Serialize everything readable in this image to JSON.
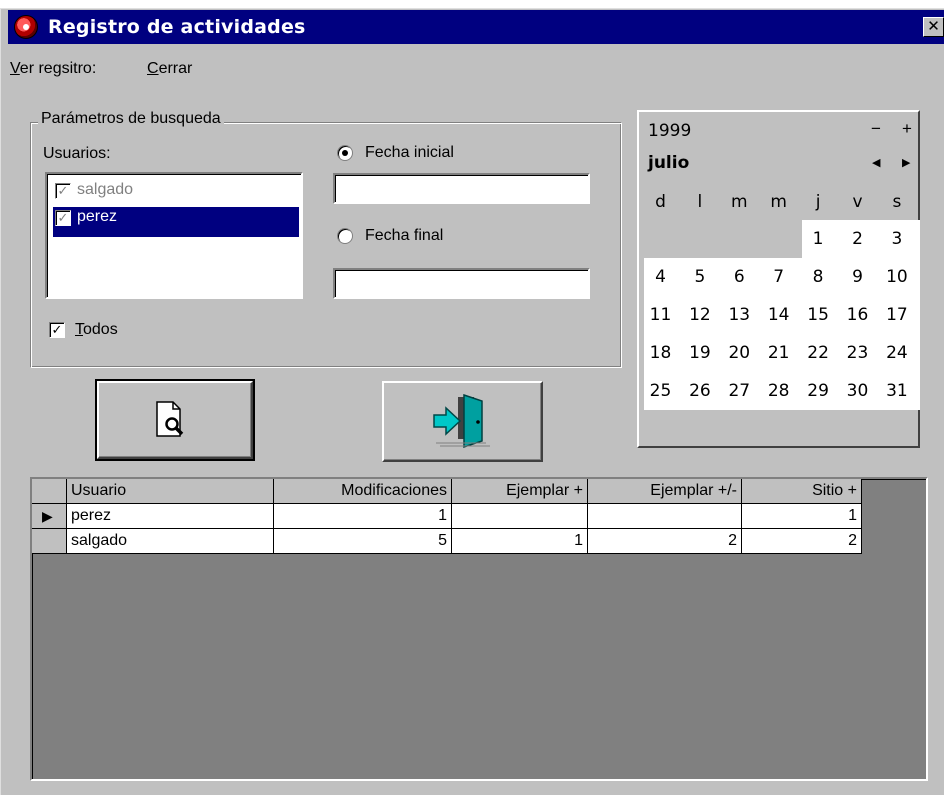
{
  "window": {
    "title": "Registro de actividades"
  },
  "menu": {
    "items": [
      "Ver regsitro:",
      "Cerrar"
    ]
  },
  "search_params": {
    "legend": "Parámetros de busqueda",
    "users_label": "Usuarios:",
    "users": [
      {
        "name": "salgado",
        "checked": true,
        "selected": false
      },
      {
        "name": "perez",
        "checked": true,
        "selected": true
      }
    ],
    "all_label": "Todos",
    "all_checked": true,
    "start_date_label": "Fecha inicial",
    "start_date_value": "",
    "end_date_label": "Fecha final",
    "end_date_value": "",
    "selected_date_option": "Fecha inicial"
  },
  "buttons": {
    "search_icon": "document-magnifier-icon",
    "exit_icon": "exit-door-icon"
  },
  "calendar": {
    "year": "1999",
    "month": "julio",
    "year_prev": "−",
    "year_next": "+",
    "month_prev": "◀",
    "month_next": "▶",
    "weekdays": [
      "d",
      "l",
      "m",
      "m",
      "j",
      "v",
      "s"
    ],
    "weeks": [
      [
        "",
        "",
        "",
        "",
        "1",
        "2",
        "3"
      ],
      [
        "4",
        "5",
        "6",
        "7",
        "8",
        "9",
        "10"
      ],
      [
        "11",
        "12",
        "13",
        "14",
        "15",
        "16",
        "17"
      ],
      [
        "18",
        "19",
        "20",
        "21",
        "22",
        "23",
        "24"
      ],
      [
        "25",
        "26",
        "27",
        "28",
        "29",
        "30",
        "31"
      ]
    ]
  },
  "table": {
    "columns": [
      "Usuario",
      "Modificaciones",
      "Ejemplar +",
      "Ejemplar +/-",
      "Sitio +"
    ],
    "rows": [
      [
        "perez",
        "1",
        "",
        "",
        "1"
      ],
      [
        "salgado",
        "5",
        "1",
        "2",
        "2"
      ]
    ],
    "current_row_indicator": "▶"
  },
  "colors": {
    "title_bar": "#000080",
    "selection": "#000080",
    "face": "#c0c0c0"
  }
}
